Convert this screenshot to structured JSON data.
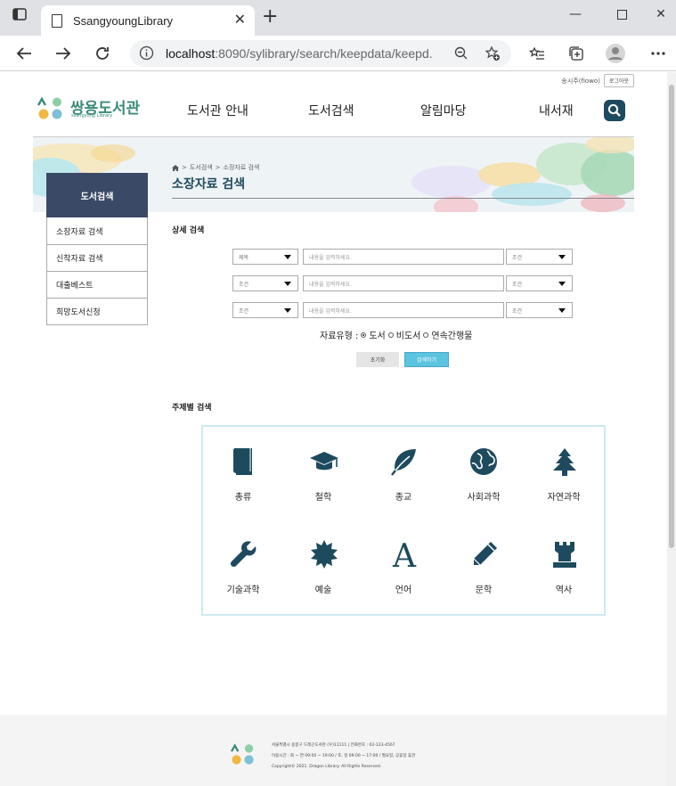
{
  "browser": {
    "tab_title": "SsangyoungLibrary",
    "url_host": "localhost",
    "url_rest": ":8090/sylibrary/search/keepdata/keepd..."
  },
  "header": {
    "user_name": "송시주(fiowo)",
    "logout_label": "로그아웃",
    "logo_name": "쌍용도서관",
    "logo_sub": "ssangyong Library",
    "nav": [
      "도서관 안내",
      "도서검색",
      "알림마당",
      "내서재"
    ]
  },
  "banner": {
    "breadcrumb": [
      "도서검색",
      "소장자료 검색"
    ],
    "title": "소장자료 검색"
  },
  "sidebar": {
    "heading": "도서검색",
    "items": [
      {
        "label": "소장자료 검색"
      },
      {
        "label": "신착자료 검색"
      },
      {
        "label": "대출베스트"
      },
      {
        "label": "희망도서신청"
      }
    ]
  },
  "detail_search": {
    "title": "상세 검색",
    "rows": [
      {
        "field": "제목",
        "placeholder": "내용을 입력하세요.",
        "cond": "조건"
      },
      {
        "field": "조건",
        "placeholder": "내용을 입력하세요.",
        "cond": "조건"
      },
      {
        "field": "조건",
        "placeholder": "내용을 입력하세요.",
        "cond": "조건"
      }
    ],
    "type_label": "자료유형 :",
    "types": [
      {
        "label": "도서",
        "checked": true
      },
      {
        "label": "비도서",
        "checked": false
      },
      {
        "label": "연속간행물",
        "checked": false
      }
    ],
    "reset_label": "초기화",
    "search_label": "검색하기"
  },
  "subject_search": {
    "title": "주제별 검색",
    "items": [
      {
        "label": "총류",
        "icon": "book-icon"
      },
      {
        "label": "철학",
        "icon": "graduation-cap-icon"
      },
      {
        "label": "종교",
        "icon": "leaf-icon"
      },
      {
        "label": "사회과학",
        "icon": "globe-icon"
      },
      {
        "label": "자연과학",
        "icon": "tree-icon"
      },
      {
        "label": "기술과학",
        "icon": "wrench-icon"
      },
      {
        "label": "예술",
        "icon": "burst-icon"
      },
      {
        "label": "언어",
        "icon": "letter-a-icon"
      },
      {
        "label": "문학",
        "icon": "pencil-icon"
      },
      {
        "label": "역사",
        "icon": "castle-tower-icon"
      }
    ]
  },
  "footer": {
    "line1": "서울특별시 용봉구 드래곤도서관 (우)11111 | 전화번호 : 02-123-4567",
    "line2": "이용시간 : 화 ~ 연 09:00 ~ 19:00 / 토, 일 09:00 ~ 17:00 / 월요일, 공휴일 휴관",
    "line3": "Copyright© 2021. Dragon Library. All Rights Reserved."
  },
  "colors": {
    "primary": "#1e4a5e",
    "sidebar_head": "#3a4a66",
    "search_button": "#5bc4e0",
    "logo_green": "#3a8a7a"
  }
}
